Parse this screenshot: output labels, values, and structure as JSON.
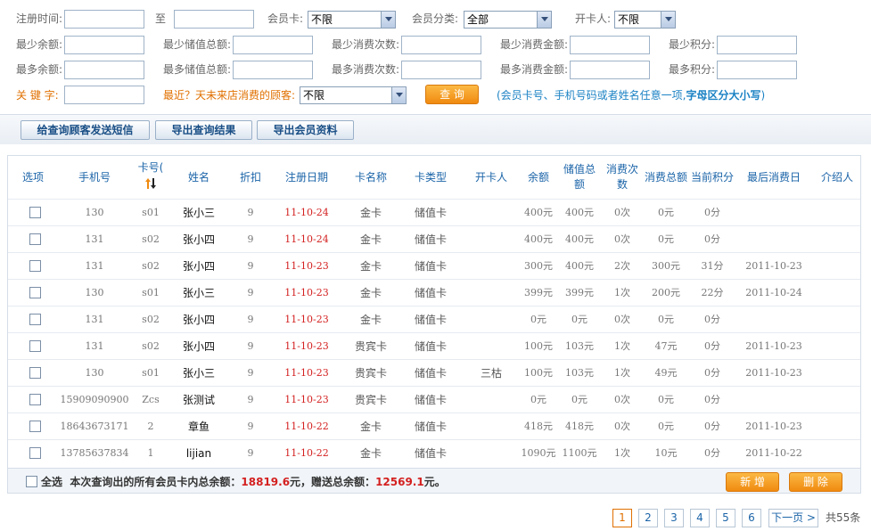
{
  "filters": {
    "reg_time_label": "注册时间:",
    "to_label": "至",
    "member_card_label": "会员卡:",
    "member_card_value": "不限",
    "member_class_label": "会员分类:",
    "member_class_value": "全部",
    "opener_label": "开卡人:",
    "opener_value": "不限",
    "min_balance": "最少余额:",
    "min_stored_total": "最少储值总额:",
    "min_consume_count": "最少消费次数:",
    "min_consume_amount": "最少消费金额:",
    "min_points": "最少积分:",
    "max_balance": "最多余额:",
    "max_stored_total": "最多储值总额:",
    "max_consume_count": "最多消费次数:",
    "max_consume_amount": "最多消费金额:",
    "max_points": "最多积分:",
    "keyword_label": "关 键 字:",
    "recent_label": "最近？天未来店消费的顾客:",
    "recent_value": "不限",
    "query_button": "查 询",
    "hint_prefix": "(会员卡号、手机号码或者姓名任意一项,",
    "hint_bold": "字母区分大小写",
    "hint_suffix": ")"
  },
  "toolbar": {
    "sms_button": "给查询顾客发送短信",
    "export_results_button": "导出查询结果",
    "export_members_button": "导出会员资料"
  },
  "table": {
    "headers": [
      "选项",
      "手机号",
      "卡号(",
      "姓名",
      "折扣",
      "注册日期",
      "卡名称",
      "卡类型",
      "开卡人",
      "余额",
      "储值总额",
      "消费次数",
      "消费总额",
      "当前积分",
      "最后消费日",
      "介绍人"
    ],
    "rows": [
      [
        "130",
        "s01",
        "张小三",
        "9",
        "11-10-24",
        "金卡",
        "储值卡",
        "",
        "400元",
        "400元",
        "0次",
        "0元",
        "0分",
        "",
        ""
      ],
      [
        "131",
        "s02",
        "张小四",
        "9",
        "11-10-24",
        "金卡",
        "储值卡",
        "",
        "400元",
        "400元",
        "0次",
        "0元",
        "0分",
        "",
        ""
      ],
      [
        "131",
        "s02",
        "张小四",
        "9",
        "11-10-23",
        "金卡",
        "储值卡",
        "",
        "300元",
        "400元",
        "2次",
        "300元",
        "31分",
        "2011-10-23",
        ""
      ],
      [
        "130",
        "s01",
        "张小三",
        "9",
        "11-10-23",
        "金卡",
        "储值卡",
        "",
        "399元",
        "399元",
        "1次",
        "200元",
        "22分",
        "2011-10-24",
        ""
      ],
      [
        "131",
        "s02",
        "张小四",
        "9",
        "11-10-23",
        "金卡",
        "储值卡",
        "",
        "0元",
        "0元",
        "0次",
        "0元",
        "0分",
        "",
        ""
      ],
      [
        "131",
        "s02",
        "张小四",
        "9",
        "11-10-23",
        "贵宾卡",
        "储值卡",
        "",
        "100元",
        "103元",
        "1次",
        "47元",
        "0分",
        "2011-10-23",
        ""
      ],
      [
        "130",
        "s01",
        "张小三",
        "9",
        "11-10-23",
        "贵宾卡",
        "储值卡",
        "三枯",
        "100元",
        "103元",
        "1次",
        "49元",
        "0分",
        "2011-10-23",
        ""
      ],
      [
        "15909090900",
        "Zcs",
        "张测试",
        "9",
        "11-10-23",
        "贵宾卡",
        "储值卡",
        "",
        "0元",
        "0元",
        "0次",
        "0元",
        "0分",
        "",
        ""
      ],
      [
        "18643673171",
        "2",
        "章鱼",
        "9",
        "11-10-22",
        "金卡",
        "储值卡",
        "",
        "418元",
        "418元",
        "0次",
        "0元",
        "0分",
        "2011-10-23",
        ""
      ],
      [
        "13785637834",
        "1",
        "lijian",
        "9",
        "11-10-22",
        "金卡",
        "储值卡",
        "",
        "1090元",
        "1100元",
        "1次",
        "10元",
        "0分",
        "2011-10-22",
        ""
      ]
    ]
  },
  "summary": {
    "select_all": "全选",
    "text_prefix": "本次查询出的所有会员卡内总余额：",
    "total_balance": "18819.6",
    "text_mid": "元，赠送总余额：",
    "gift_balance": "12569.1",
    "text_suffix": "元。",
    "add_button": "新 增",
    "delete_button": "删 除"
  },
  "pager": {
    "pages": [
      "1",
      "2",
      "3",
      "4",
      "5",
      "6"
    ],
    "current": "1",
    "next_label": "下一页 >",
    "total_text": "共55条"
  },
  "colors": {
    "accent_orange": "#f08a10",
    "link_blue": "#1b64a8",
    "date_red": "#d42020"
  },
  "icons": {
    "sort": "sort-up-down-icon",
    "dropdown": "chevron-down-icon"
  }
}
